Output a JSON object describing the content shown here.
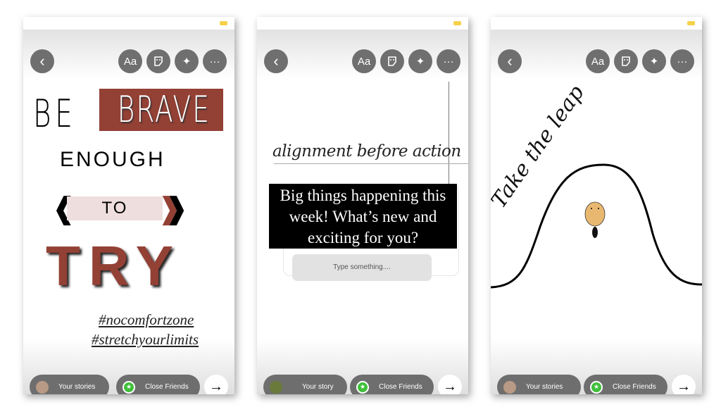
{
  "controls": {
    "aa_label": "Aa",
    "more_label": "···",
    "back_label": "‹",
    "next_arrow": "→",
    "sticker_icon": "sticker-icon",
    "effects_icon": "sparkles-icon"
  },
  "colors": {
    "button_bg": "#6f6f6f",
    "brick_red": "#934035",
    "pink_band": "#efdede",
    "close_friends_green": "#3fbf3a",
    "battery": "#f6d24b"
  },
  "screens": [
    {
      "story": {
        "line1": "BE",
        "line2": "BRAVE",
        "line3": "ENOUGH",
        "line4": "TO",
        "line5": "TRY",
        "hashtag1": "#nocomfortzone",
        "hashtag2": "#stretchyourlimits"
      },
      "share": {
        "your_label": "Your stories",
        "close_friends_label": "Close Friends"
      }
    },
    {
      "story": {
        "headline": "alignment before action",
        "question": "Big things happening this week! What’s new and exciting for you?",
        "input_placeholder": "Type something...."
      },
      "share": {
        "your_label": "Your story",
        "close_friends_label": "Close Friends"
      }
    },
    {
      "story": {
        "script_text": "Take the leap"
      },
      "share": {
        "your_label": "Your stories",
        "close_friends_label": "Close Friends"
      }
    }
  ]
}
